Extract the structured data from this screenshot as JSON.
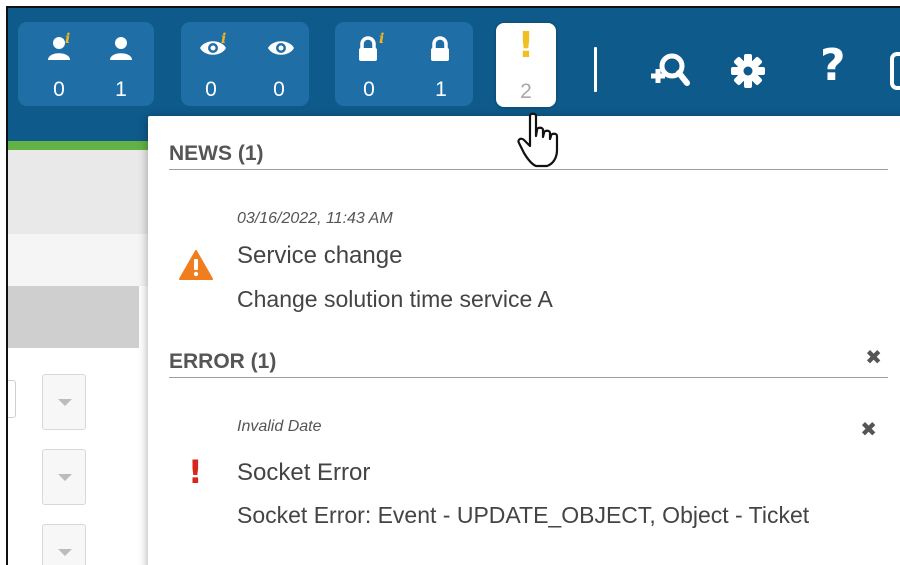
{
  "toolbar": {
    "groups": [
      {
        "name": "users",
        "cells": [
          {
            "icon": "user-info-icon",
            "count": "0",
            "badge": "i"
          },
          {
            "icon": "user-icon",
            "count": "1"
          }
        ]
      },
      {
        "name": "observed",
        "cells": [
          {
            "icon": "eye-info-icon",
            "count": "0",
            "badge": "i"
          },
          {
            "icon": "eye-icon",
            "count": "0"
          }
        ]
      },
      {
        "name": "locks",
        "cells": [
          {
            "icon": "lock-info-icon",
            "count": "0",
            "badge": "i"
          },
          {
            "icon": "lock-icon",
            "count": "1"
          }
        ]
      }
    ],
    "alerts": {
      "icon": "exclamation-icon",
      "symbol": "!",
      "count": "2"
    },
    "tools": [
      "search-user-icon",
      "gear-icon",
      "help-icon",
      "window-icon"
    ],
    "help_symbol": "?"
  },
  "notifications": {
    "news": {
      "heading": "NEWS (1)",
      "items": [
        {
          "date": "03/16/2022, 11:43 AM",
          "title": "Service change",
          "body": "Change solution time service A",
          "icon": "warning-triangle-icon"
        }
      ]
    },
    "error": {
      "heading": "ERROR (1)",
      "close_symbol": "✖",
      "items": [
        {
          "date": "Invalid Date",
          "title": "Socket Error",
          "body": "Socket Error: Event - UPDATE_OBJECT, Object - Ticket",
          "icon": "red-exclamation-icon",
          "close_symbol": "✖",
          "symbol": "!"
        }
      ]
    }
  },
  "colors": {
    "topbar": "#0e5a8a",
    "group_bg": "#1f6fa6",
    "accent_green": "#63b246",
    "info_badge": "#f0b41e",
    "warning": "#f07d1e",
    "error": "#d9261c"
  }
}
